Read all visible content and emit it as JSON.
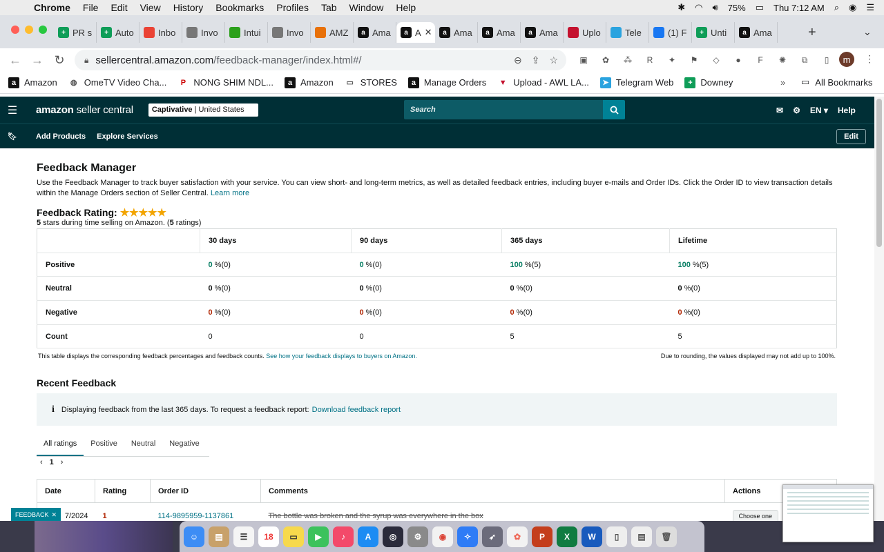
{
  "macbar": {
    "app": "Chrome",
    "menus": [
      "File",
      "Edit",
      "View",
      "History",
      "Bookmarks",
      "Profiles",
      "Tab",
      "Window",
      "Help"
    ],
    "battery": "75%",
    "clock": "Thu 7:12 AM"
  },
  "tabs": [
    {
      "label": "PR s",
      "icon": "sheets-icon",
      "color": "#0f9d58"
    },
    {
      "label": "Auto",
      "icon": "sheets-icon",
      "color": "#0f9d58"
    },
    {
      "label": "Inbo",
      "icon": "gmail-icon",
      "color": "#ea4335"
    },
    {
      "label": "Invo",
      "icon": "globe-icon",
      "color": "#777777"
    },
    {
      "label": "Intui",
      "icon": "intuit-icon",
      "color": "#2ca01c"
    },
    {
      "label": "Invo",
      "icon": "globe-icon",
      "color": "#777777"
    },
    {
      "label": "AMZ",
      "icon": "pen-icon",
      "color": "#e8710a"
    },
    {
      "label": "Ama",
      "icon": "amazon-icon",
      "color": "#111111"
    },
    {
      "label": "A",
      "icon": "amazon-icon",
      "color": "#111111",
      "active": true
    },
    {
      "label": "Ama",
      "icon": "amazon-icon",
      "color": "#111111"
    },
    {
      "label": "Ama",
      "icon": "amazon-icon",
      "color": "#111111"
    },
    {
      "label": "Ama",
      "icon": "amazon-icon",
      "color": "#111111"
    },
    {
      "label": "Uplo",
      "icon": "awl-icon",
      "color": "#c4122f"
    },
    {
      "label": "Tele",
      "icon": "telegram-icon",
      "color": "#2aa3df"
    },
    {
      "label": "(1) F",
      "icon": "facebook-icon",
      "color": "#1877f2"
    },
    {
      "label": "Unti",
      "icon": "sheets-icon",
      "color": "#0f9d58"
    },
    {
      "label": "Ama",
      "icon": "amazon-icon",
      "color": "#111111"
    }
  ],
  "address": {
    "host": "sellercentral.amazon.com",
    "path": "/feedback-manager/index.html#/"
  },
  "bookmarks": [
    {
      "label": "Amazon",
      "icon": "amazon-icon"
    },
    {
      "label": "OmeTV Video Cha...",
      "icon": "globe-icon"
    },
    {
      "label": "NONG SHIM NDL...",
      "icon": "pinterest-icon"
    },
    {
      "label": "Amazon",
      "icon": "amazon-icon"
    },
    {
      "label": "STORES",
      "icon": "folder-icon"
    },
    {
      "label": "Manage Orders",
      "icon": "amazon-icon"
    },
    {
      "label": "Upload - AWL LA...",
      "icon": "awl-icon"
    },
    {
      "label": "Telegram Web",
      "icon": "telegram-icon"
    },
    {
      "label": "Downey",
      "icon": "sheets-icon"
    }
  ],
  "bookmarks_more": "»",
  "all_bookmarks": "All Bookmarks",
  "seller": {
    "logo_a": "amazon",
    "logo_b": " seller central",
    "account_name": "Captivative",
    "account_region": " | United States",
    "search_placeholder": "Search",
    "language": "EN",
    "help": "Help",
    "sub_items": [
      "Add Products",
      "Explore Services"
    ],
    "edit": "Edit"
  },
  "page": {
    "title": "Feedback Manager",
    "intro": "Use the Feedback Manager to track buyer satisfaction with your service. You can view short- and long-term metrics, as well as detailed feedback entries, including buyer e-mails and Order IDs. Click the Order ID to view transaction details within the Manage Orders section of Seller Central.",
    "learn_more": "Learn more",
    "rating_label": "Feedback Rating:",
    "stars": "★★★★★",
    "rating_sub_stars": "5",
    "rating_sub_text": " stars during time selling on Amazon. (",
    "rating_sub_count": "5",
    "rating_sub_end": " ratings)"
  },
  "rating_table": {
    "headers": [
      "30 days",
      "90 days",
      "365 days",
      "Lifetime"
    ],
    "rows": [
      {
        "label": "Positive",
        "kind": "pos",
        "values": [
          [
            "0",
            " %(0)"
          ],
          [
            "0",
            " %(0)"
          ],
          [
            "100",
            " %(5)"
          ],
          [
            "100",
            " %(5)"
          ]
        ]
      },
      {
        "label": "Neutral",
        "kind": "zero",
        "values": [
          [
            "0",
            " %(0)"
          ],
          [
            "0",
            " %(0)"
          ],
          [
            "0",
            " %(0)"
          ],
          [
            "0",
            " %(0)"
          ]
        ]
      },
      {
        "label": "Negative",
        "kind": "neg",
        "values": [
          [
            "0",
            " %(0)"
          ],
          [
            "0",
            " %(0)"
          ],
          [
            "0",
            " %(0)"
          ],
          [
            "0",
            " %(0)"
          ]
        ]
      },
      {
        "label": "Count",
        "kind": "plain",
        "values": [
          [
            "0",
            ""
          ],
          [
            "0",
            ""
          ],
          [
            "5",
            ""
          ],
          [
            "5",
            ""
          ]
        ]
      }
    ],
    "note": "This table displays the corresponding feedback percentages and feedback counts.",
    "note_link": "See how your feedback displays to buyers on Amazon.",
    "rounding_note": "Due to rounding, the values displayed may not add up to 100%."
  },
  "recent": {
    "title": "Recent Feedback",
    "info": "Displaying feedback from the last 365 days. To request a feedback report:",
    "info_link": "Download feedback report",
    "tabs": [
      "All ratings",
      "Positive",
      "Neutral",
      "Negative"
    ],
    "page": "1",
    "columns": [
      "Date",
      "Rating",
      "Order ID",
      "Comments",
      "Actions"
    ],
    "rows": [
      {
        "date": "7/2024",
        "rating": "1",
        "order_id": "114-9895959-1137861",
        "comment": "The bottle was broken and the syrup was everywhere in the box",
        "action": "Choose one"
      }
    ]
  },
  "feedback_tab": "FEEDBACK",
  "colors": {
    "seller_header": "#002f36",
    "link": "#007185",
    "positive": "#067d62",
    "negative": "#b12704",
    "star": "#f2a400"
  }
}
